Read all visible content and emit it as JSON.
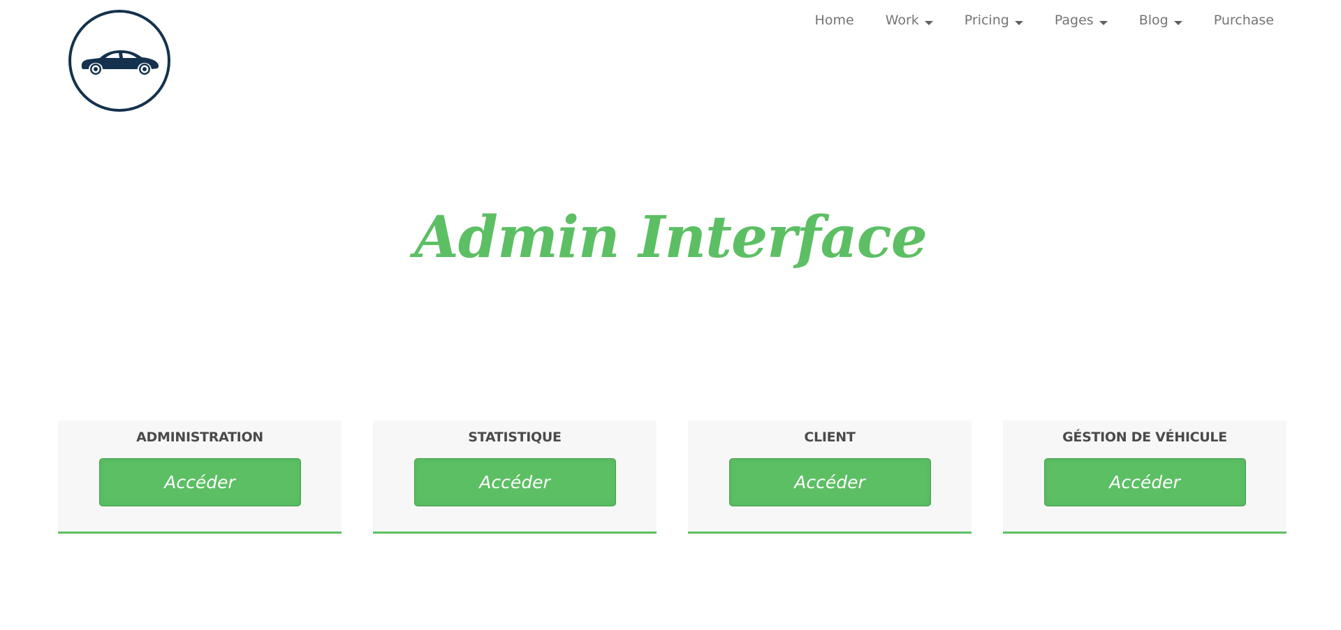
{
  "header": {
    "logo_icon": "car-icon",
    "nav": {
      "home": "Home",
      "work": "Work",
      "pricing": "Pricing",
      "pages": "Pages",
      "blog": "Blog",
      "purchase": "Purchase"
    }
  },
  "main": {
    "title": "Admin Interface",
    "cards": [
      {
        "title": "ADMINISTRATION",
        "button": "Accéder"
      },
      {
        "title": "STATISTIQUE",
        "button": "Accéder"
      },
      {
        "title": "CLIENT",
        "button": "Accéder"
      },
      {
        "title": "GÉSTION DE VÉHICULE",
        "button": "Accéder"
      }
    ]
  },
  "colors": {
    "accent_green": "#5cbf64",
    "logo_navy": "#14324d",
    "card_background": "#f7f7f7",
    "nav_text": "#747474"
  }
}
